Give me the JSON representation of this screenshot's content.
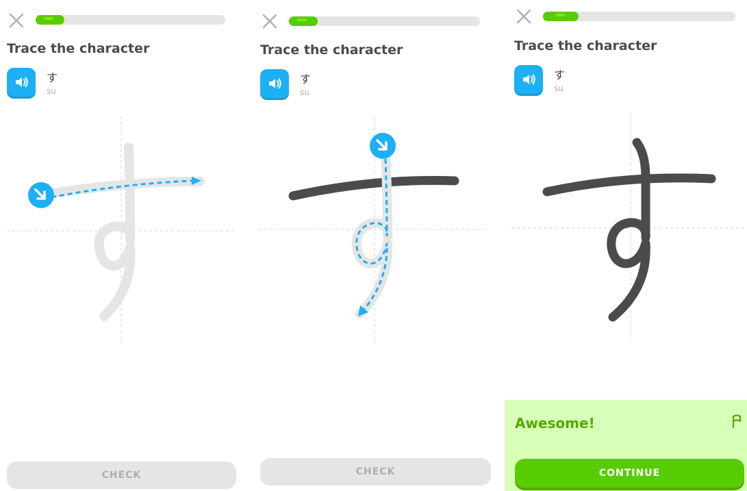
{
  "panels": [
    {
      "title": "Trace the character",
      "character": "す",
      "romaji": "su",
      "check_label": "CHECK"
    },
    {
      "title": "Trace the character",
      "character": "す",
      "romaji": "su",
      "check_label": "CHECK"
    },
    {
      "title": "Trace the character",
      "character": "す",
      "romaji": "su",
      "feedback_label": "Awesome!",
      "continue_label": "CONTINUE"
    }
  ],
  "progress_fraction": 0.15,
  "colors": {
    "accent_green": "#58cc02",
    "accent_blue": "#1cb0f6",
    "stroke_guide": "#e5e5e5",
    "stroke_done": "#4b4b4b",
    "feedback_bg": "#d7ffb8"
  },
  "icons": [
    "close-icon",
    "speaker-icon",
    "start-arrow-icon",
    "flag-icon"
  ]
}
